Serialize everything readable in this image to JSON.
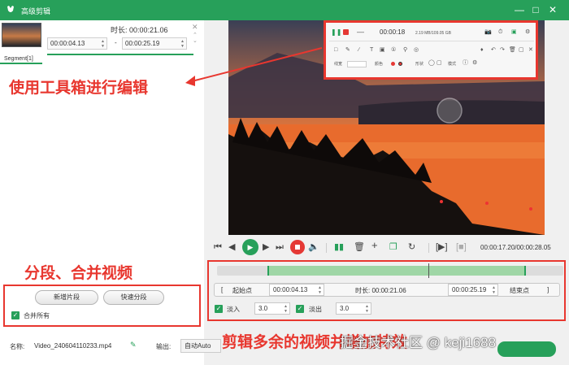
{
  "window": {
    "title": "高级剪辑",
    "accent": "#27a05a",
    "callout_color": "#e8372f"
  },
  "segment_panel": {
    "segment_label": "Segment[1]",
    "duration_label": "时长: 00:00:21.06",
    "start_time": "00:00:04.13",
    "separator": "-",
    "end_time": "00:00:25.19"
  },
  "callouts": {
    "toolbox": "使用工具箱进行编辑",
    "merge": "分段、合并视频",
    "trim": "剪辑多余的视频并增加特效"
  },
  "buttons": {
    "new_segment": "新增片段",
    "quick_split": "快速分段",
    "merge_all": "合并所有"
  },
  "player": {
    "time_display": "00:00:17.20/00:00:28.05"
  },
  "trim_row": {
    "start_bracket": "[",
    "start_label": "起始点",
    "start_time": "00:00:04.13",
    "duration_label": "时长: 00:00:21.06",
    "end_time": "00:00:25.19",
    "end_label": "结束点",
    "end_bracket": "]"
  },
  "fade_row": {
    "fade_in_label": "淡入",
    "fade_in_value": "3.0",
    "fade_out_label": "淡出",
    "fade_out_value": "3.0"
  },
  "toolbox_overlay": {
    "time": "00:00:18",
    "size": "2.19 MB/109.05 GB",
    "line_width_label": "线宽",
    "color_label": "颜色",
    "shape_label": "形状",
    "mode_label": "模式"
  },
  "footer": {
    "name_label": "名称:",
    "file_name": "Video_240604110233.mp4",
    "output_label": "输出:",
    "output_value": "自动Auto"
  },
  "watermark": "掘金技术社区 @ keji1688"
}
